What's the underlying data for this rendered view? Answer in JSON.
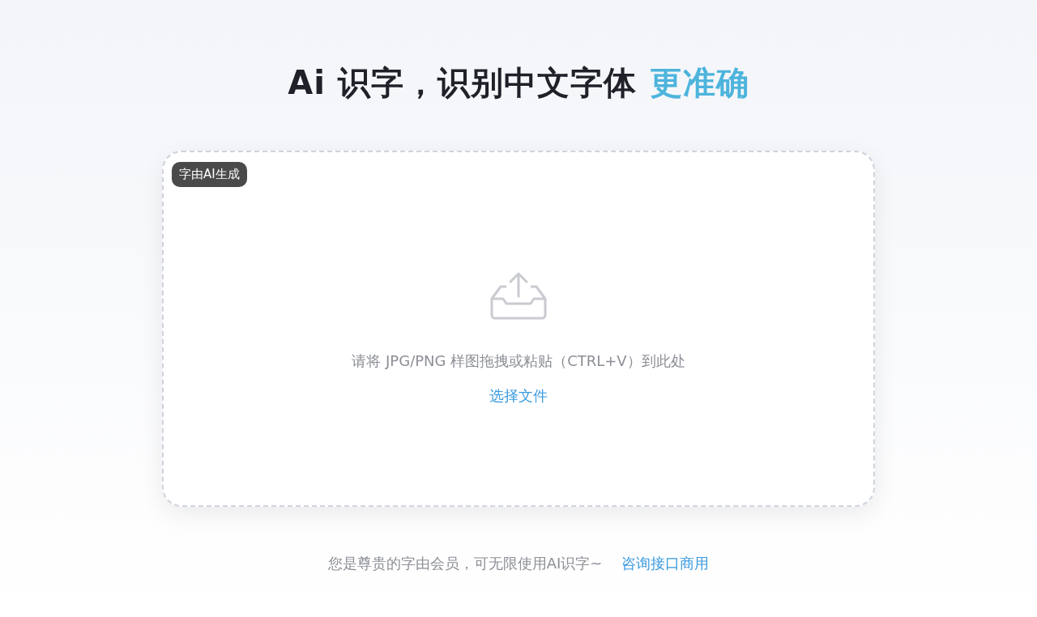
{
  "headline": {
    "text": "Ai 识字，识别中文字体",
    "accent": "更准确"
  },
  "upload": {
    "badge": "字由AI生成",
    "hint": "请将 JPG/PNG 样图拖拽或粘贴（CTRL+V）到此处",
    "button": "选择文件"
  },
  "footer": {
    "note": "您是尊贵的字由会员，可无限使用AI识字~",
    "link": "咨询接口商用"
  }
}
